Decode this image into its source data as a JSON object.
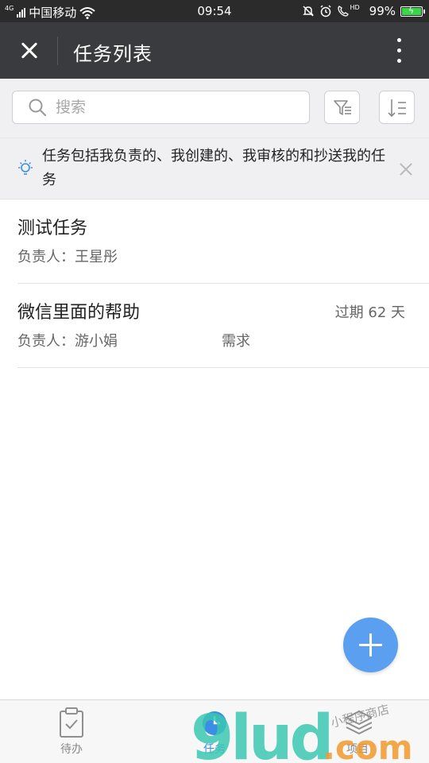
{
  "status_bar": {
    "network": "4G",
    "carrier": "中国移动",
    "time": "09:54",
    "hd": "HD",
    "battery": "99%"
  },
  "header": {
    "title": "任务列表"
  },
  "search": {
    "placeholder": "搜索"
  },
  "tip": {
    "text": "任务包括我负责的、我创建的、我审核的和抄送我的任务"
  },
  "tasks": [
    {
      "title": "测试任务",
      "owner_label": "负责人：",
      "owner": "王星彤",
      "overdue": "",
      "type": ""
    },
    {
      "title": "微信里面的帮助",
      "owner_label": "负责人：",
      "owner": "游小娟",
      "overdue": "过期 62 天",
      "type": "需求"
    }
  ],
  "tabs": [
    {
      "label": "待办",
      "active": false
    },
    {
      "label": "任务",
      "active": true
    },
    {
      "label": "项目",
      "active": false
    }
  ],
  "watermark": {
    "brand": "9lud",
    "domain": ".com",
    "note": "小程序商店"
  },
  "colors": {
    "header_bg": "#3a3b3e",
    "accent": "#5b9ff0",
    "battery": "#3cd64a"
  }
}
